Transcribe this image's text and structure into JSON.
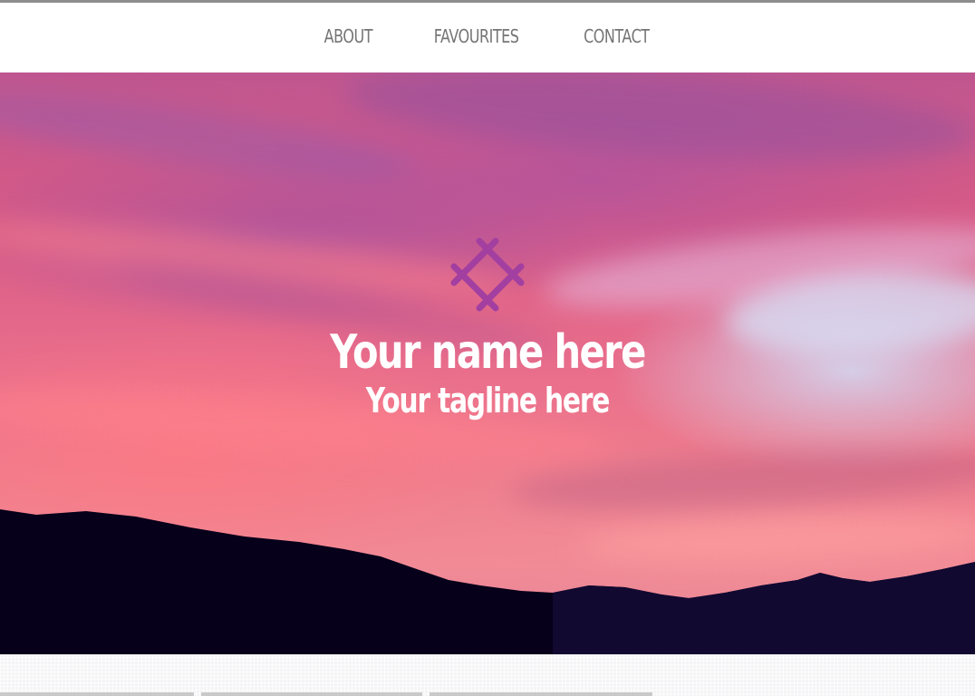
{
  "nav": {
    "items": [
      {
        "label": "ABOUT"
      },
      {
        "label": "FAVOURITES"
      },
      {
        "label": "CONTACT"
      }
    ]
  },
  "hero": {
    "title": "Your name here",
    "tagline": "Your tagline here",
    "logo_icon": "crosshatch-logo-icon"
  },
  "colors": {
    "nav_text": "#757575",
    "logo": "#a23fa0",
    "hero_text": "#ffffff",
    "mountain": "#06001a"
  }
}
